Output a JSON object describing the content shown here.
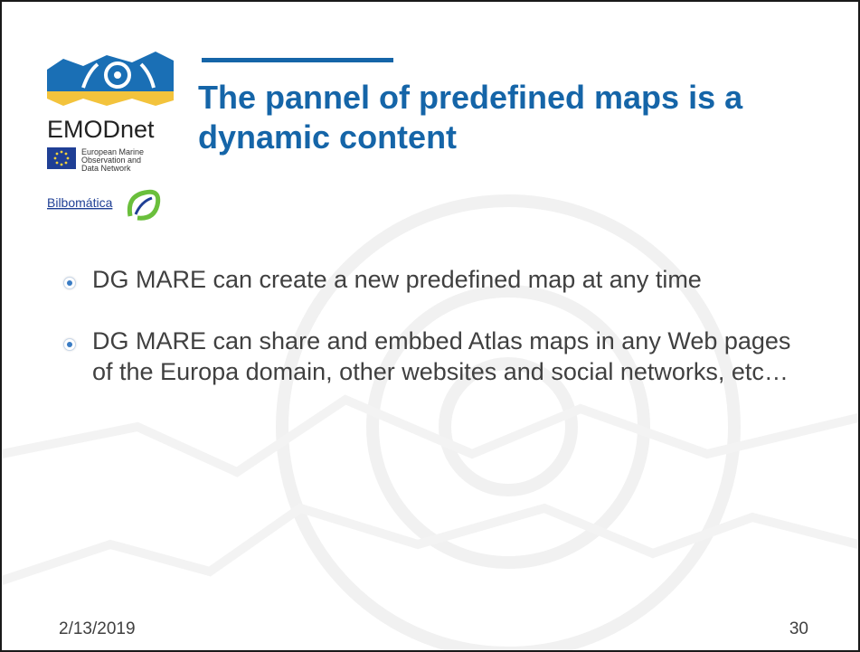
{
  "slide": {
    "title": "The pannel of predefined maps is a dynamic content",
    "bullets": [
      "DG MARE can create a new predefined map at any time",
      "DG MARE can share and embbed Atlas maps in any Web pages of the Europa domain, other websites and social networks, etc…"
    ],
    "footer": {
      "date": "2/13/2019",
      "page_number": "30"
    }
  },
  "logo": {
    "name": "EMODnet",
    "subtitle_lines": [
      "European Marine",
      "Observation and",
      "Data Network"
    ],
    "partner": "Bilbomática"
  },
  "colors": {
    "title": "#1565a8",
    "body_text": "#404040",
    "logo_blue": "#1a6fb5",
    "logo_yellow": "#f3c33c",
    "eu_flag": "#1f3f95"
  }
}
